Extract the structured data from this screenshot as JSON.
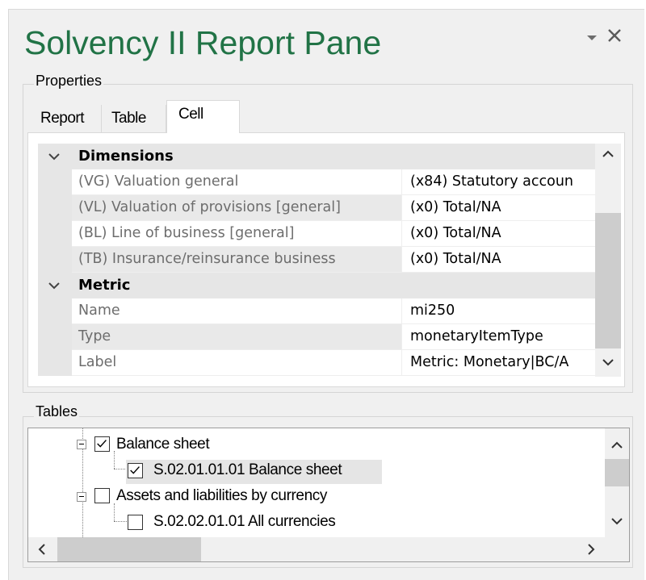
{
  "pane": {
    "title": "Solvency II Report Pane",
    "menu_icon": "triangle-down-icon",
    "close_icon": "close-icon",
    "title_color": "#217346"
  },
  "properties": {
    "label": "Properties",
    "tabs": [
      {
        "label": "Report",
        "active": false
      },
      {
        "label": "Table",
        "active": false
      },
      {
        "label": "Cell",
        "active": true
      }
    ],
    "categories": [
      {
        "label": "Dimensions",
        "rows": [
          {
            "name": "(VG) Valuation general",
            "value": "(x84) Statutory accoun"
          },
          {
            "name": "(VL) Valuation of provisions [general]",
            "value": "(x0) Total/NA"
          },
          {
            "name": "(BL) Line of business [general]",
            "value": "(x0) Total/NA"
          },
          {
            "name": "(TB) Insurance/reinsurance business",
            "value": "(x0) Total/NA"
          }
        ]
      },
      {
        "label": "Metric",
        "rows": [
          {
            "name": "Name",
            "value": "mi250"
          },
          {
            "name": "Type",
            "value": "monetaryItemType"
          },
          {
            "name": "Label",
            "value": "Metric: Monetary|BC/A"
          }
        ]
      }
    ]
  },
  "tables": {
    "label": "Tables",
    "items": [
      {
        "label": "Balance sheet",
        "checked": true,
        "level": 0,
        "expanded": true
      },
      {
        "label": "S.02.01.01.01 Balance sheet",
        "checked": true,
        "level": 1,
        "selected": true
      },
      {
        "label": "Assets and liabilities by currency",
        "checked": false,
        "level": 0,
        "expanded": true
      },
      {
        "label": "S.02.02.01.01 All currencies",
        "checked": false,
        "level": 1
      }
    ]
  }
}
